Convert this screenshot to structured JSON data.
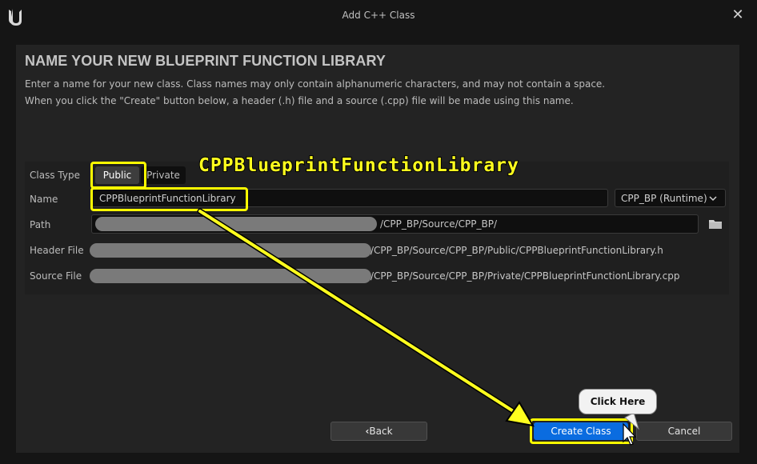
{
  "window": {
    "title": "Add C++ Class",
    "close_glyph": "✕",
    "logo_icon": "unreal-engine-logo-icon"
  },
  "header": {
    "heading": "NAME YOUR NEW BLUEPRINT FUNCTION LIBRARY",
    "description_line1": "Enter a name for your new class. Class names may only contain alphanumeric characters, and may not contain a space.",
    "description_line2": "When you click the \"Create\" button below, a header (.h) file and a source (.cpp) file will be made using this name."
  },
  "form": {
    "class_type_label": "Class Type",
    "class_type_options": [
      "Public",
      "Private"
    ],
    "class_type_selected": "Public",
    "name_label": "Name",
    "name_value": "CPPBlueprintFunctionLibrary",
    "module_value": "CPP_BP (Runtime)",
    "module_chevron": "chevron-down-icon",
    "path_label": "Path",
    "path_suffix": "/CPP_BP/Source/CPP_BP/",
    "folder_icon": "folder-icon",
    "header_file_label": "Header File",
    "header_file_suffix": "/CPP_BP/Source/CPP_BP/Public/CPPBlueprintFunctionLibrary.h",
    "source_file_label": "Source File",
    "source_file_suffix": "/CPP_BP/Source/CPP_BP/Private/CPPBlueprintFunctionLibrary.cpp"
  },
  "footer": {
    "back_label": "Back",
    "back_glyph": "‹",
    "create_label": "Create Class",
    "cancel_label": "Cancel"
  },
  "annotations": {
    "big_label": "CPPBlueprintFunctionLibrary",
    "callout": "Click Here",
    "highlight_color": "#ffff00"
  },
  "colors": {
    "primary_button": "#0a6ce0",
    "panel": "#232323",
    "background": "#151515"
  }
}
